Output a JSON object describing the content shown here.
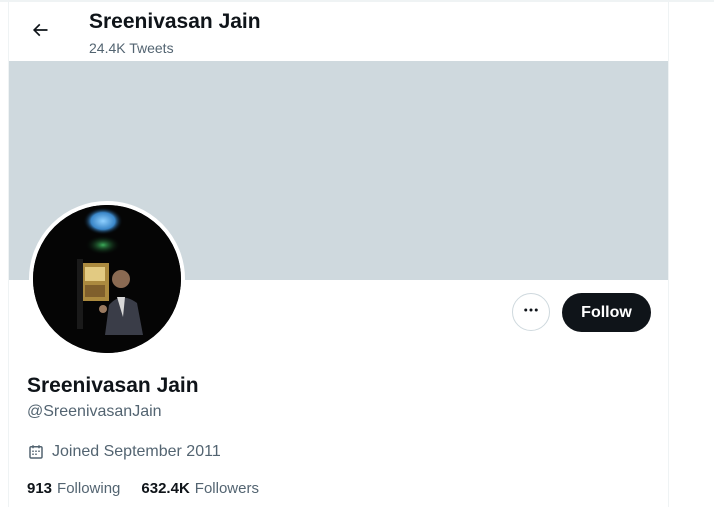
{
  "header": {
    "title": "Sreenivasan Jain",
    "tweet_count": "24.4K Tweets",
    "back_icon": "arrow-left-icon"
  },
  "banner": {
    "color": "#cfd9de"
  },
  "profile": {
    "display_name": "Sreenivasan Jain",
    "handle": "@SreenivasanJain",
    "joined": "Joined September 2011",
    "joined_icon": "calendar-icon"
  },
  "actions": {
    "more_icon": "more-horizontal-icon",
    "follow_label": "Follow",
    "follow_color": "#0f1419"
  },
  "stats": {
    "following_count": "913",
    "following_label": "Following",
    "followers_count": "632.4K",
    "followers_label": "Followers"
  }
}
